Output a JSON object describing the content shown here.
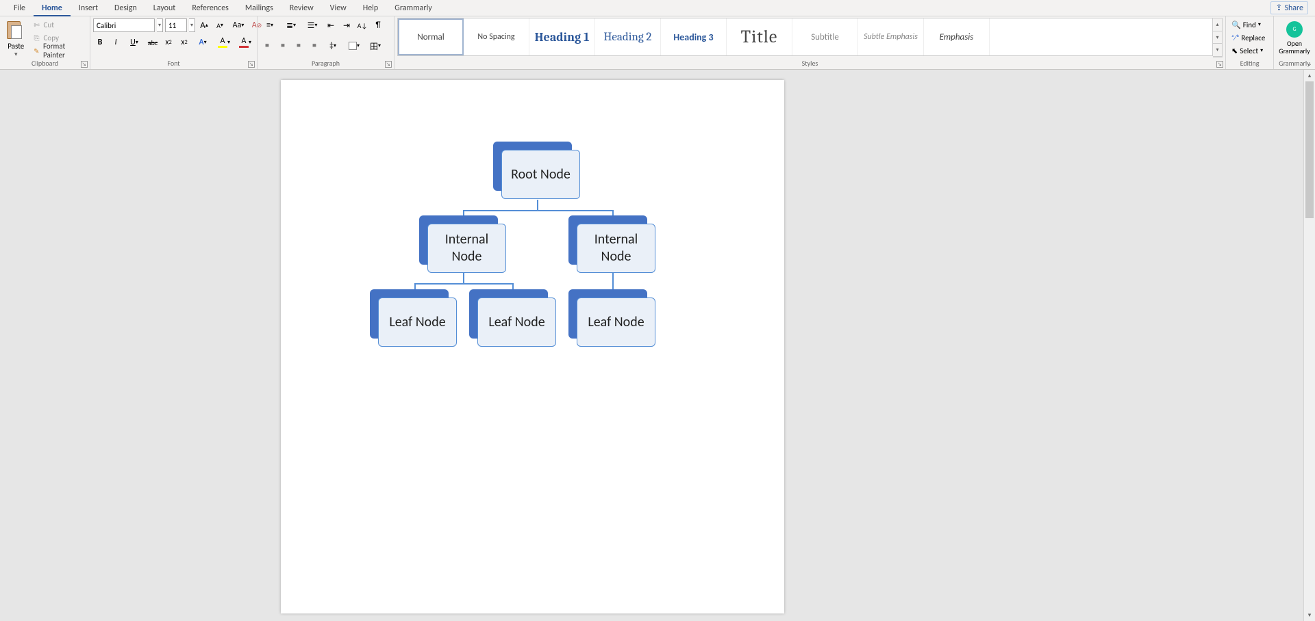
{
  "tabs": {
    "file": "File",
    "home": "Home",
    "insert": "Insert",
    "design": "Design",
    "layout": "Layout",
    "references": "References",
    "mailings": "Mailings",
    "review": "Review",
    "view": "View",
    "help": "Help",
    "grammarly": "Grammarly"
  },
  "share": "Share",
  "clipboard": {
    "paste": "Paste",
    "cut": "Cut",
    "copy": "Copy",
    "format_painter": "Format Painter",
    "group": "Clipboard"
  },
  "font": {
    "name": "Calibri",
    "size": "11",
    "group": "Font",
    "bold": "B",
    "italic": "I",
    "underline": "U",
    "strike": "abc",
    "sub": "x",
    "sup": "x",
    "caseAa": "Aa",
    "clear": "A",
    "grow": "A",
    "shrink": "A",
    "textfx": "A",
    "highlight": "A",
    "fontcolor": "A"
  },
  "paragraph": {
    "group": "Paragraph"
  },
  "styles": {
    "group": "Styles",
    "items": [
      "Normal",
      "No Spacing",
      "Heading 1",
      "Heading 2",
      "Heading 3",
      "Title",
      "Subtitle",
      "Subtle Emphasis",
      "Emphasis"
    ]
  },
  "editing": {
    "group": "Editing",
    "find": "Find",
    "replace": "Replace",
    "select": "Select"
  },
  "grammarly": {
    "group": "Grammarly",
    "open": "Open Grammarly"
  },
  "smartart": {
    "root": "Root Node",
    "internal_left": "Internal Node",
    "internal_right": "Internal Node",
    "leaf1": "Leaf Node",
    "leaf2": "Leaf Node",
    "leaf3": "Leaf Node"
  }
}
